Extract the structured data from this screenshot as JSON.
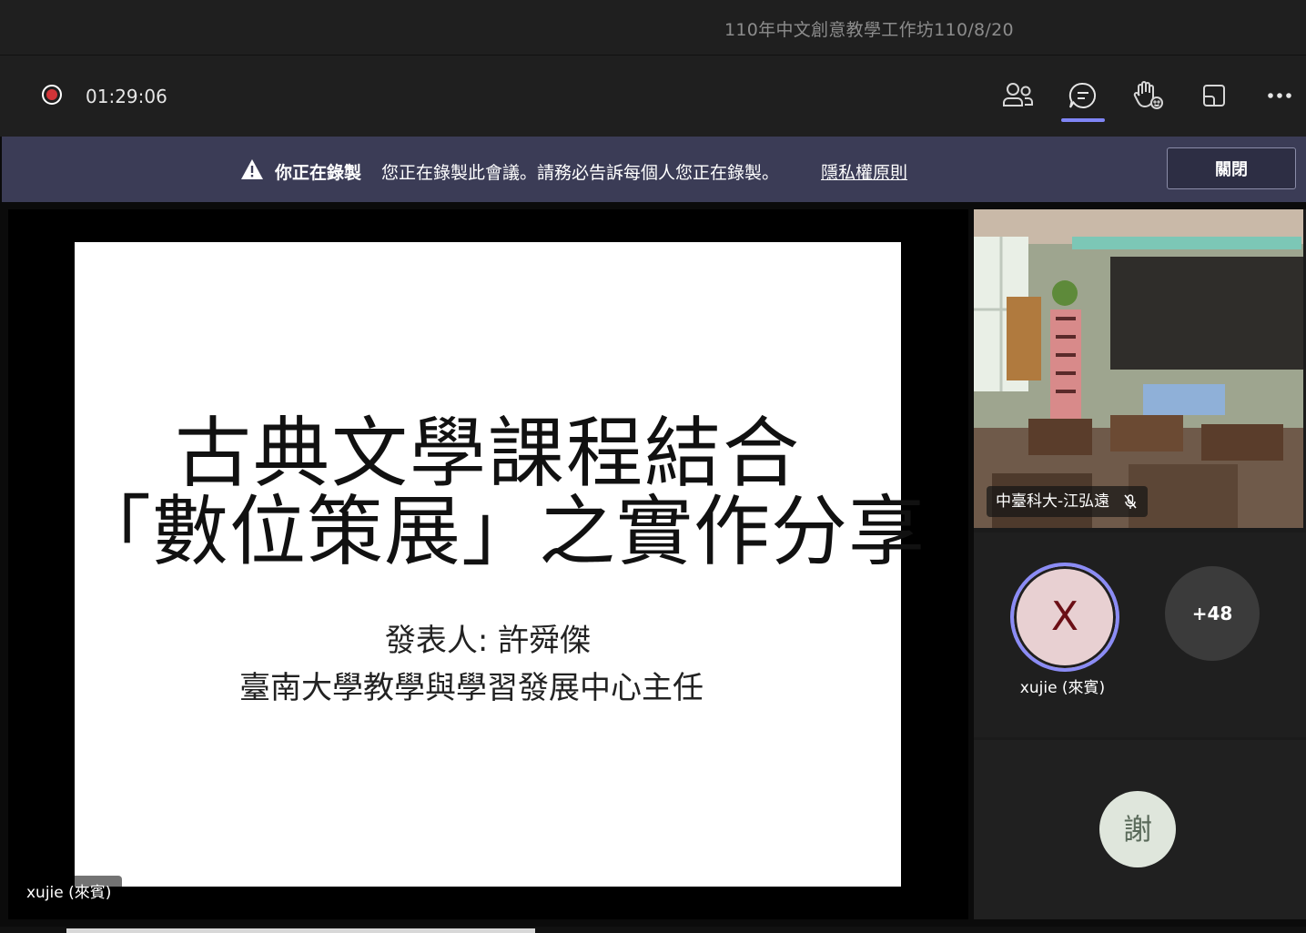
{
  "window": {
    "title": "110年中文創意教學工作坊110/8/20"
  },
  "toolbar": {
    "timer": "01:29:06",
    "icons": [
      "record-icon",
      "people-icon",
      "chat-icon",
      "raise-hand-icon",
      "share-screen-icon",
      "more-icon"
    ]
  },
  "banner": {
    "title": "你正在錄製",
    "message": "您正在錄製此會議。請務必告訴每個人您正在錄製。",
    "link": "隱私權原則",
    "close_label": "關閉"
  },
  "slide": {
    "title_line1": "古典文學課程結合",
    "title_line2": "「數位策展」之實作分享",
    "presenter": "發表人: 許舜傑",
    "affiliation": "臺南大學教學與學習發展中心主任"
  },
  "main_stage": {
    "nametag": "xujie (來賓)"
  },
  "participants": {
    "tile1_name": "中臺科大-江弘遠",
    "tile2_initial": "X",
    "tile2_name": "xujie (來賓)",
    "overflow_count": "+48",
    "tile3_initial": "謝"
  },
  "colors": {
    "accent": "#7f85f5",
    "banner_bg": "#3b3c56",
    "record_red": "#d13438",
    "toolbar_bg": "#1f1f1f"
  }
}
